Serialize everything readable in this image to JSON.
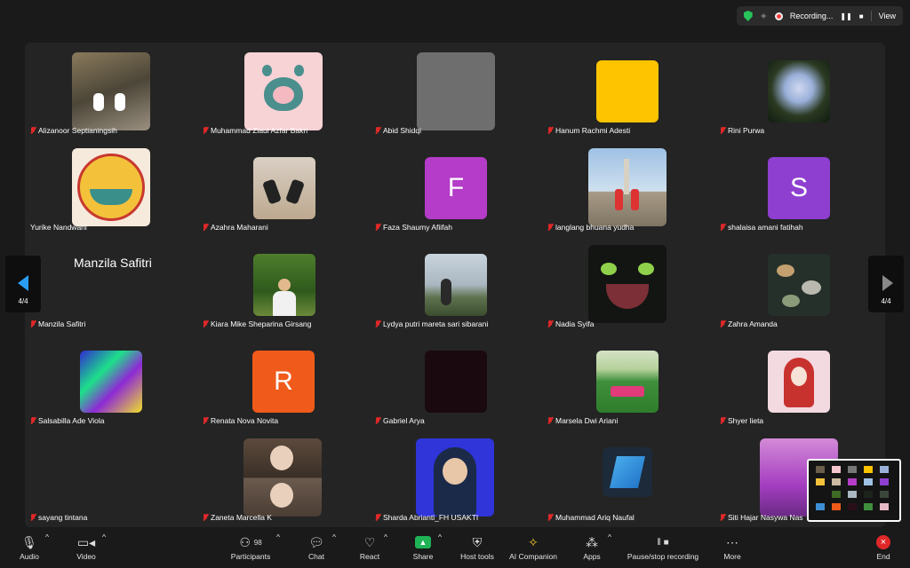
{
  "topbar": {
    "recording_label": "Recording...",
    "view_label": "View"
  },
  "pagination": {
    "left_page": "4/4",
    "right_page": "4/4"
  },
  "participants": [
    {
      "name": "Alizanoor Septianingsih"
    },
    {
      "name": "Muhammad Ziaul Azfar Bakri"
    },
    {
      "name": "Abid Shidqi"
    },
    {
      "name": "Hanum Rachmi Adesti"
    },
    {
      "name": "Rini Purwa"
    },
    {
      "name": "Yurike Nandwani"
    },
    {
      "name": "Azahra Maharani"
    },
    {
      "name": "Faza Shaumy Afiifah",
      "letter": "F"
    },
    {
      "name": "langlang bhuana yudha"
    },
    {
      "name": "shalaisa amani fatihah",
      "letter": "S"
    },
    {
      "name": "Manzila Safitri",
      "display": "Manzila Safitri"
    },
    {
      "name": "Kiara Mike Sheparina Girsang"
    },
    {
      "name": "Lydya putri mareta sari sibarani"
    },
    {
      "name": "Nadia Syifa"
    },
    {
      "name": "Zahra Amanda"
    },
    {
      "name": "Salsabilla Ade Viola"
    },
    {
      "name": "Renata Nova Novita",
      "letter": "R"
    },
    {
      "name": "Gabriel Arya"
    },
    {
      "name": "Marsela Dwi Ariani"
    },
    {
      "name": "Shyer lieta"
    },
    {
      "name": "sayang tintana"
    },
    {
      "name": "Zaneta Marcella K"
    },
    {
      "name": "Sharda Abrianti_FH USAKTI"
    },
    {
      "name": "Muhammad Ariq Naufal"
    },
    {
      "name": "Siti Hajar Nasywa Nas"
    }
  ],
  "toolbar": {
    "audio": "Audio",
    "video": "Video",
    "participants": "Participants",
    "participants_count": "98",
    "chat": "Chat",
    "react": "React",
    "share": "Share",
    "host_tools": "Host tools",
    "ai_companion": "AI Companion",
    "apps": "Apps",
    "pause_stop": "Pause/stop recording",
    "more": "More",
    "end": "End"
  },
  "colors": {
    "muted_mic": "#e02828",
    "active_arrow": "#2a9df4",
    "share_green": "#1fb356",
    "end_red": "#e02828"
  }
}
